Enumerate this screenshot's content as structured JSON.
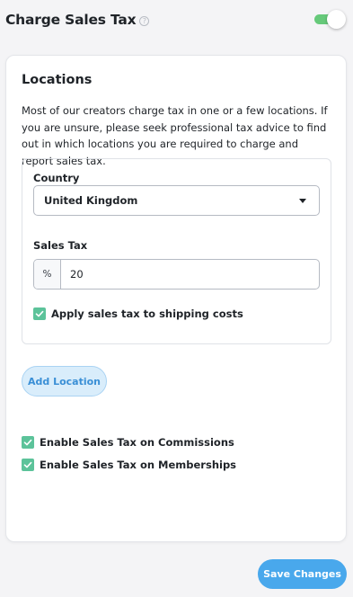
{
  "header": {
    "title": "Charge Sales Tax",
    "help_icon": "?",
    "toggle_on": true,
    "accent_color": "#66c97a"
  },
  "locations": {
    "title": "Locations",
    "description": "Most of our creators charge tax in one or a few locations. If you are unsure, please seek professional tax advice to find out in which locations you are required to charge and report sales tax.",
    "country_label": "Country",
    "country_value": "United Kingdom",
    "sales_tax_label": "Sales Tax",
    "sales_tax_prefix": "%",
    "sales_tax_value": "20",
    "shipping_label": "Apply sales tax to shipping costs",
    "shipping_checked": true
  },
  "add_location_label": "Add Location",
  "options": {
    "commissions_label": "Enable Sales Tax on Commissions",
    "commissions_checked": true,
    "memberships_label": "Enable Sales Tax on Memberships",
    "memberships_checked": true
  },
  "save_label": "Save Changes"
}
